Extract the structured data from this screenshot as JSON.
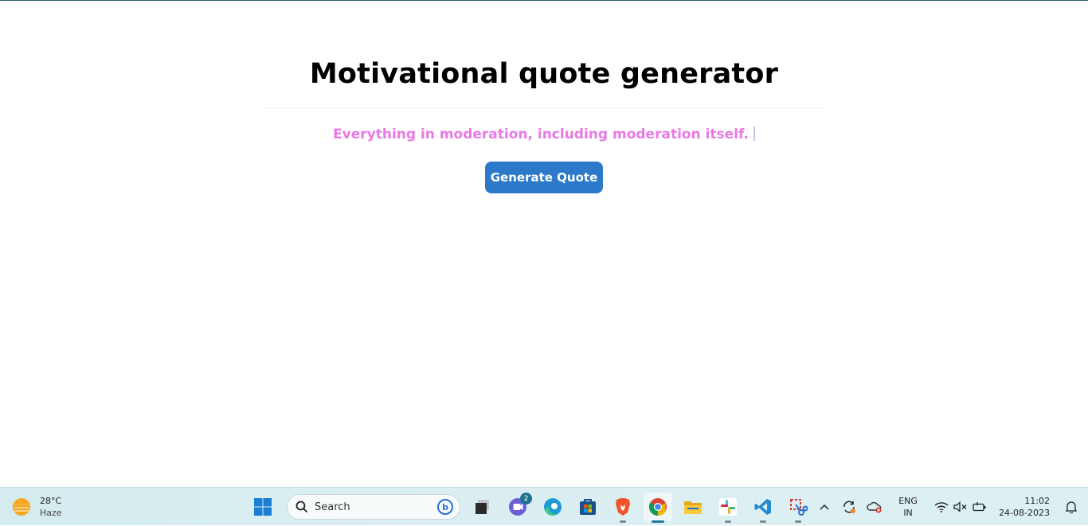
{
  "app": {
    "title": "Motivational quote generator",
    "quote": "Everything in moderation, including moderation itself.",
    "button_label": "Generate Quote"
  },
  "taskbar": {
    "weather": {
      "temp": "28°C",
      "condition": "Haze",
      "icon": "sun-haze-icon"
    },
    "search": {
      "placeholder": "Search"
    },
    "apps": [
      {
        "name": "start-button",
        "icon": "windows-logo-icon"
      },
      {
        "name": "task-view",
        "icon": "task-view-icon"
      },
      {
        "name": "teams-chat",
        "icon": "chat-icon",
        "badge": "2"
      },
      {
        "name": "edge",
        "icon": "edge-icon"
      },
      {
        "name": "store",
        "icon": "store-icon"
      },
      {
        "name": "brave",
        "icon": "brave-icon"
      },
      {
        "name": "chrome",
        "icon": "chrome-icon",
        "active": true
      },
      {
        "name": "file-explorer",
        "icon": "folder-icon"
      },
      {
        "name": "slack",
        "icon": "slack-icon"
      },
      {
        "name": "vscode",
        "icon": "vscode-icon"
      },
      {
        "name": "snipping-tool",
        "icon": "snipping-tool-icon"
      }
    ],
    "tray": {
      "lang_line1": "ENG",
      "lang_line2": "IN",
      "time": "11:02",
      "date": "24-08-2023"
    }
  },
  "colors": {
    "accent_button": "#2b79c8",
    "quote_text": "#e87ae6",
    "taskbar_bg": "#d8eef1"
  }
}
